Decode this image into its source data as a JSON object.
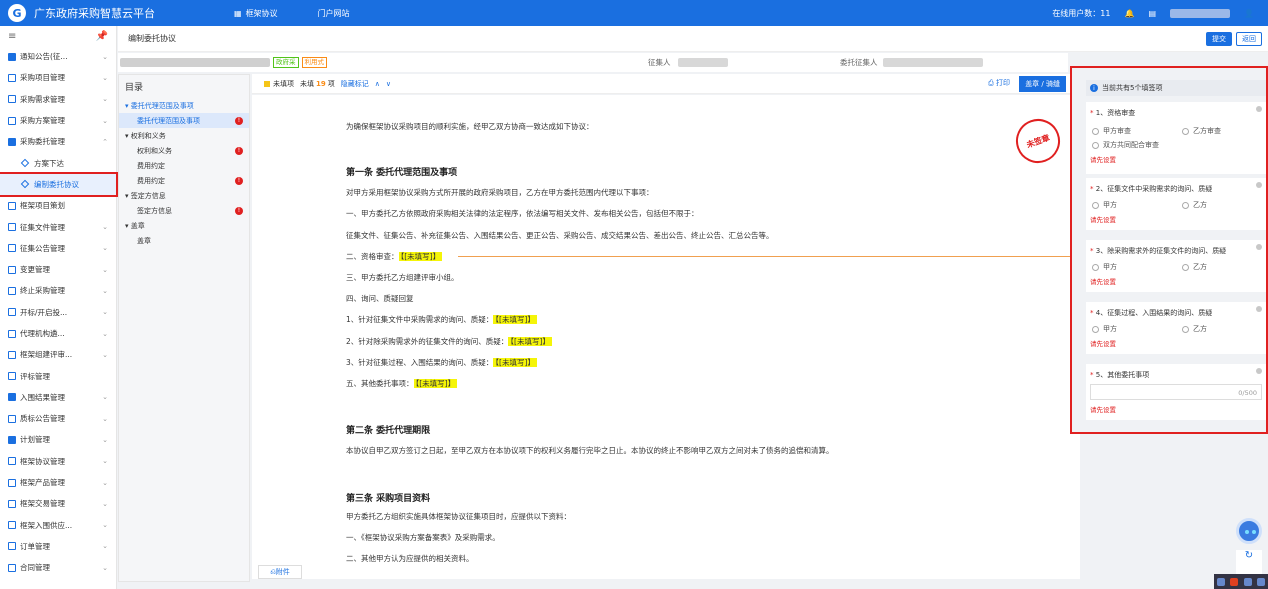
{
  "app": {
    "title": "广东政府采购智慧云平台",
    "nav": [
      "框架协议",
      "门户网站"
    ],
    "online_label": "在线用户数：11"
  },
  "sidebar": {
    "items": [
      "通知公告(征...",
      "采购项目管理",
      "采购需求管理",
      "采购方案管理",
      "采购委托管理",
      "方案下达",
      "编制委托协议",
      "框架项目策划",
      "征集文件管理",
      "征集公告管理",
      "变更管理",
      "终止采购管理",
      "开标/开启投...",
      "代理机构遴...",
      "框架组建评审...",
      "评标管理",
      "入围结果管理",
      "质标公告管理",
      "计划管理",
      "框架协议管理",
      "框架产品管理",
      "框架交易管理",
      "框架入围供应...",
      "订单管理",
      "合同管理"
    ]
  },
  "crumb": {
    "title": "编制委托协议",
    "submit": "提交",
    "back": "返回"
  },
  "info": {
    "tags": [
      "政府采",
      "利用式"
    ],
    "collect": "征集人",
    "principal": "委托征集人"
  },
  "toc": {
    "title": "目录",
    "items": [
      {
        "label": "委托代理范围及事项",
        "level": "l1"
      },
      {
        "label": "委托代理范围及事项",
        "level": "sel",
        "badge": "!"
      },
      {
        "label": "权利和义务",
        "level": "l1g"
      },
      {
        "label": "权利和义务",
        "level": "l2",
        "badge": "!"
      },
      {
        "label": "费用约定",
        "level": "l2"
      },
      {
        "label": "费用约定",
        "level": "l2",
        "badge": "!"
      },
      {
        "label": "签定方信息",
        "level": "l1g"
      },
      {
        "label": "签定方信息",
        "level": "l2",
        "badge": "!"
      },
      {
        "label": "盖章",
        "level": "l1g"
      },
      {
        "label": "盖章",
        "level": "l2"
      }
    ]
  },
  "docbar": {
    "unfilled_label": "未填项",
    "unfilled_prefix": "未填",
    "unfilled_count": "19",
    "unfilled_suffix": "项",
    "hide_mark": "隐藏标记",
    "print": "打印",
    "verify": "盖章 / 骑缝"
  },
  "doc": {
    "stamp": "未签章",
    "intro": "为确保框架协议采购项目的顺利实施，经甲乙双方协商一致达成如下协议：",
    "s1": "第一条  委托代理范围及事项",
    "s1p1": "对甲方采用框架协议采购方式所开展的政府采购项目，乙方在甲方委托范围内代理以下事项：",
    "s1p2": "一、甲方委托乙方依照政府采购相关法律的法定程序，依法编写相关文件、发布相关公告，包括但不限于：",
    "s1p3": "征集文件、征集公告、补充征集公告、入围结果公告、更正公告、采购公告、成交结果公告、差出公告、终止公告、汇总公告等。",
    "s1p4": "二、资格审查：",
    "fill": "【[未填写]】",
    "s1p5": "三、甲方委托乙方组建评审小组。",
    "s1p6": "四、询问、质疑回复",
    "s1p7": "1、针对征集文件中采购需求的询问、质疑：",
    "s1p8": "2、针对除采购需求外的征集文件的询问、质疑：",
    "s1p9": "3、针对征集过程、入围结果的询问、质疑：",
    "s1p10": "五、其他委托事项：",
    "s2": "第二条  委托代理期限",
    "s2p1": "本协议自甲乙双方签订之日起，至甲乙双方在本协议项下的权利义务履行完毕之日止。本协议的终止不影响甲乙双方之间对未了债务的追偿和清算。",
    "s3": "第三条  采购项目资料",
    "s3p1": "甲方委托乙方组织实施具体框架协议征集项目时，应提供以下资料：",
    "s3p2": "一、《框架协议采购方案备案表》及采购需求。",
    "s3p3": "二、其他甲方认为应提供的相关资料。"
  },
  "attach": "附件",
  "panel": {
    "header": "当前共有5个填签项",
    "warn": "请先设置",
    "questions": [
      {
        "title": "1、资格审查",
        "options": [
          "甲方审查",
          "乙方审查",
          "双方共同配合审查"
        ]
      },
      {
        "title": "2、征集文件中采购需求的询问、质疑",
        "options": [
          "甲方",
          "乙方"
        ]
      },
      {
        "title": "3、除采购需求外的征集文件的询问、质疑",
        "options": [
          "甲方",
          "乙方"
        ]
      },
      {
        "title": "4、征集过程、入围结果的询问、质疑",
        "options": [
          "甲方",
          "乙方"
        ]
      },
      {
        "title": "5、其他委托事项",
        "counter": "0/500"
      }
    ]
  }
}
